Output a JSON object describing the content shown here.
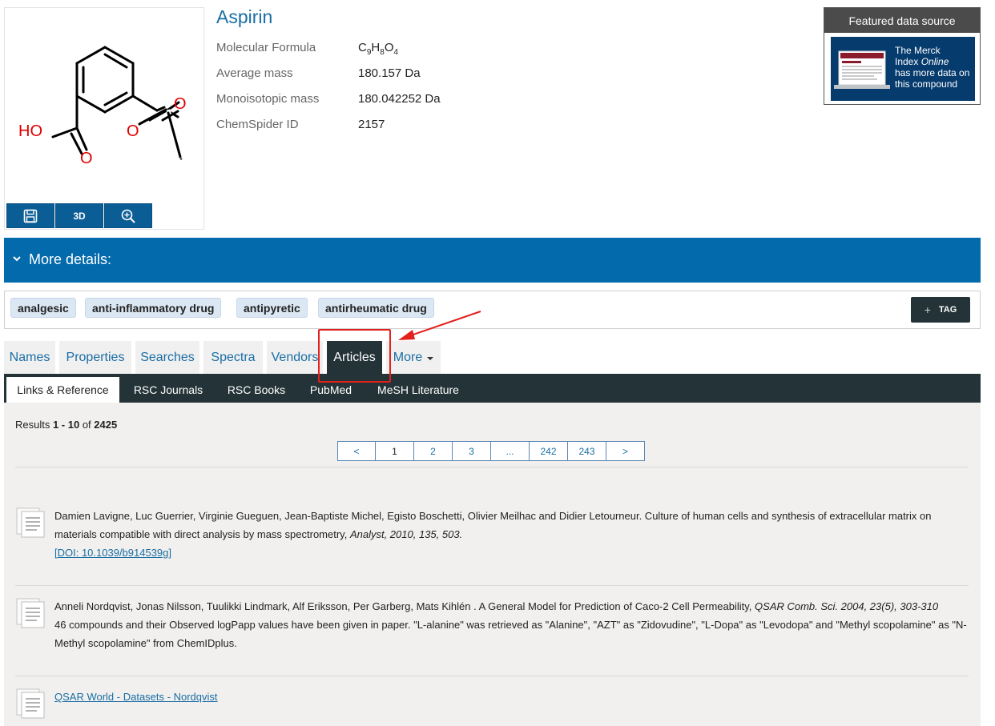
{
  "compound": {
    "name": "Aspirin",
    "structure_atoms": {
      "hydroxyl": "HO",
      "oxygen": "O"
    },
    "properties": [
      {
        "label": "Molecular Formula",
        "value": "C",
        "formula": [
          "C",
          "9",
          "H",
          "8",
          "O",
          "4"
        ]
      },
      {
        "label": "Average mass",
        "value": "180.157 Da"
      },
      {
        "label": "Monoisotopic mass",
        "value": "180.042252 Da"
      },
      {
        "label": "ChemSpider ID",
        "value": "2157"
      }
    ],
    "image_buttons": {
      "save_icon": "floppy-disk-icon",
      "three_d_label": "3D",
      "zoom_icon": "zoom-in-icon"
    }
  },
  "featured": {
    "title": "Featured data source",
    "line1": "The Merck",
    "line2a": "Index ",
    "line2b": "Online",
    "line3": "has more data on",
    "line4": "this compound"
  },
  "more_details": {
    "label": "More details:",
    "icon": "chevron-down-icon"
  },
  "tags": {
    "items": [
      "analgesic",
      "anti-inflammatory drug",
      "antipyretic",
      "antirheumatic drug"
    ],
    "add_label": "TAG",
    "add_symbol": "+"
  },
  "tabs": {
    "main": [
      "Names",
      "Properties",
      "Searches",
      "Spectra",
      "Vendors",
      "Articles",
      "More"
    ],
    "active": "Articles",
    "sub": [
      "Links & Reference",
      "RSC Journals",
      "RSC Books",
      "PubMed",
      "MeSH Literature"
    ],
    "sub_active": "Links & Reference"
  },
  "results": {
    "prefix": "Results ",
    "range": "1 - 10",
    "of": " of ",
    "total": "2425"
  },
  "pagination": [
    "<",
    "1",
    "2",
    "3",
    "...",
    "242",
    "243",
    ">"
  ],
  "articles": [
    {
      "authors": "Damien Lavigne, Luc Guerrier, Virginie Gueguen, Jean-Baptiste Michel, Egisto Boschetti, Olivier Meilhac and Didier Letourneur. Culture of human cells and synthesis of extracellular matrix on materials compatible with direct analysis by mass spectrometry, ",
      "citation": "Analyst, 2010, 135, 503.",
      "doi": "[DOI: 10.1039/b914539g]"
    },
    {
      "authors": "Anneli Nordqvist, Jonas Nilsson, Tuulikki Lindmark, Alf Eriksson, Per Garberg, Mats Kihlén . A General Model for Prediction of Caco-2 Cell Permeability, ",
      "citation": "QSAR Comb. Sci. 2004, 23(5), 303-310",
      "note": "46 compounds and their Observed logPapp values have been given in paper. \"L-alanine\" was retrieved as \"Alanine\", \"AZT\" as \"Zidovudine\", \"L-Dopa\" as \"Levodopa\" and \"Methyl scopolamine\" as \"N-Methyl scopolamine\" from ChemIDplus."
    },
    {
      "link": "QSAR World - Datasets - Nordqvist"
    }
  ],
  "colors": {
    "brand_blue": "#036aab",
    "dark_tab": "#243337",
    "annotation_red": "#e4201c"
  }
}
